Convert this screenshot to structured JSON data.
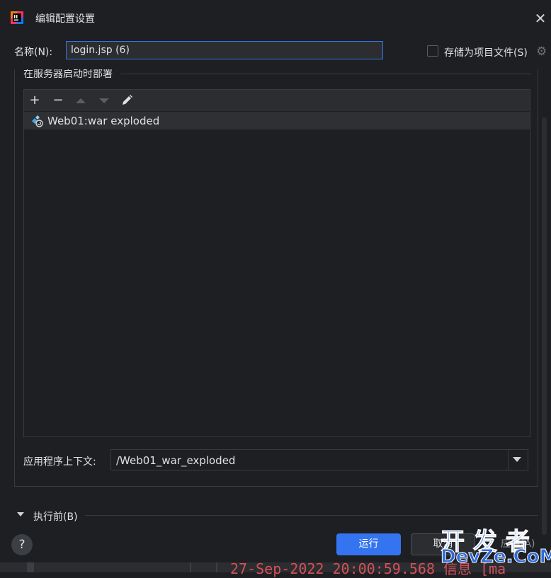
{
  "window": {
    "title": "编辑配置设置"
  },
  "name_field": {
    "label": "名称(N):",
    "value": "login.jsp (6)"
  },
  "save_as_project_file": {
    "label": "存储为项目文件(S)",
    "checked": false
  },
  "deployment": {
    "group_title": "在服务器启动时部署",
    "items": [
      {
        "label": "Web01:war exploded",
        "icon": "artifact-icon"
      }
    ]
  },
  "app_context": {
    "label": "应用程序上下文:",
    "value": "/Web01_war_exploded"
  },
  "before_launch": {
    "label": "执行前(B)"
  },
  "buttons": {
    "help": "?",
    "run": "运行",
    "cancel": "取消",
    "apply": "应用(A)"
  },
  "background_log": {
    "text": "27-Sep-2022 20:00:59.568 信息 [ma"
  },
  "watermark": {
    "top": "开发者",
    "bottom": "DevZe.CoM"
  },
  "colors": {
    "accent": "#3574f0",
    "background": "#1e1f22",
    "panel": "#2b2d30",
    "log_red": "#d5505a"
  }
}
